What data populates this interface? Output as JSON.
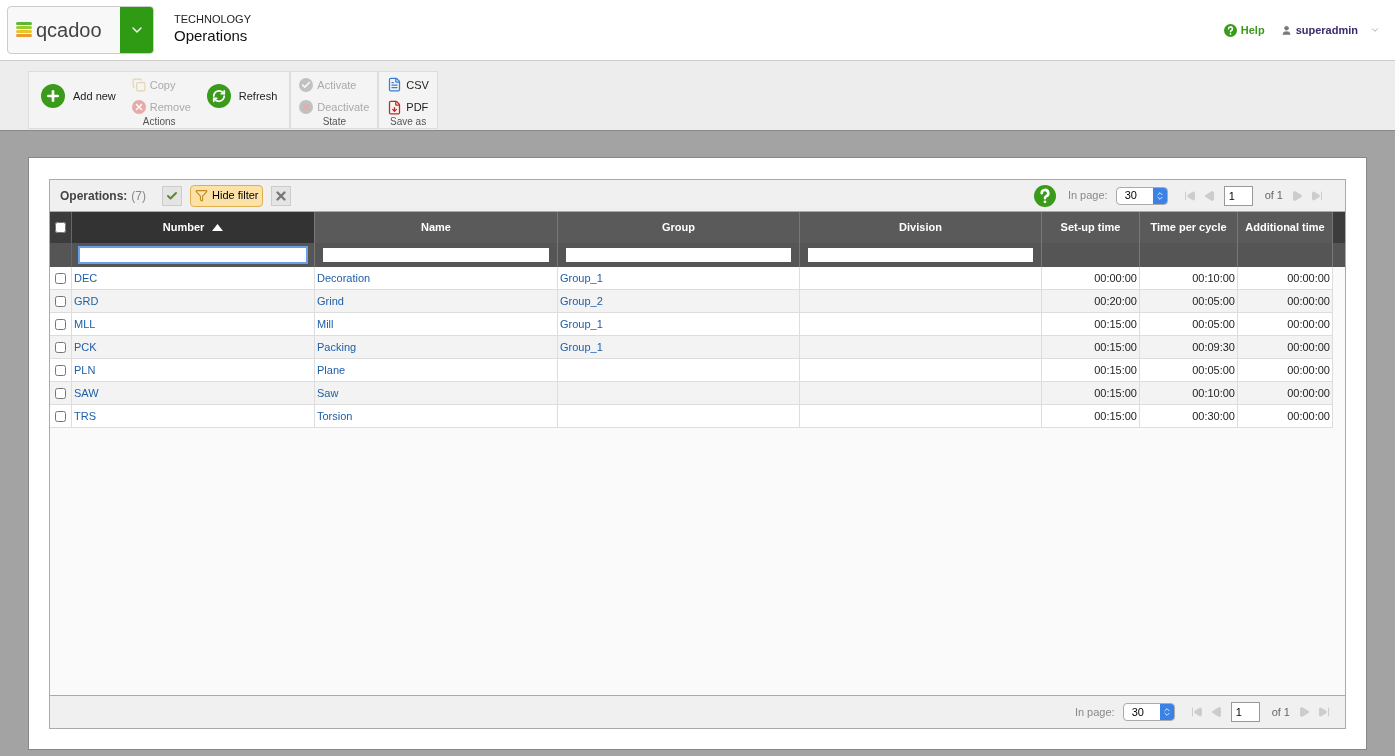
{
  "header": {
    "logo": "qcadoo",
    "section": "TECHNOLOGY",
    "title": "Operations",
    "help": "Help",
    "user": "superadmin"
  },
  "toolbar": [
    {
      "label": "Actions",
      "buttons": [
        {
          "label": "Add new",
          "kind": "add",
          "disabled": false
        },
        {
          "label": "Copy",
          "kind": "copy",
          "disabled": true
        },
        {
          "label": "Remove",
          "kind": "remove",
          "disabled": true
        },
        {
          "label": "Refresh",
          "kind": "refresh",
          "disabled": false
        }
      ]
    },
    {
      "label": "State",
      "buttons": [
        {
          "label": "Activate",
          "kind": "activate",
          "disabled": true
        },
        {
          "label": "Deactivate",
          "kind": "deactivate",
          "disabled": true
        }
      ]
    },
    {
      "label": "Save as",
      "buttons": [
        {
          "label": "CSV",
          "kind": "csv",
          "disabled": false
        },
        {
          "label": "PDF",
          "kind": "pdf",
          "disabled": false
        }
      ]
    }
  ],
  "grid": {
    "title": "Operations:",
    "count": "(7)",
    "filter_button": "Hide filter",
    "filter_on": true,
    "all_checked": false,
    "columns": [
      {
        "label": "Number",
        "sorted": true,
        "kind": "link"
      },
      {
        "label": "Name",
        "sorted": false,
        "kind": "link"
      },
      {
        "label": "Group",
        "sorted": false,
        "kind": "link"
      },
      {
        "label": "Division",
        "sorted": false,
        "kind": "link"
      },
      {
        "label": "Set-up time",
        "sorted": false,
        "kind": "time"
      },
      {
        "label": "Time per cycle",
        "sorted": false,
        "kind": "time"
      },
      {
        "label": "Additional time",
        "sorted": false,
        "kind": "time"
      }
    ],
    "rows": [
      {
        "checked": false,
        "cells": [
          "DEC",
          "Decoration",
          "Group_1",
          "",
          "00:00:00",
          "00:10:00",
          "00:00:00"
        ]
      },
      {
        "checked": false,
        "cells": [
          "GRD",
          "Grind",
          "Group_2",
          "",
          "00:20:00",
          "00:05:00",
          "00:00:00"
        ]
      },
      {
        "checked": false,
        "cells": [
          "MLL",
          "Mill",
          "Group_1",
          "",
          "00:15:00",
          "00:05:00",
          "00:00:00"
        ]
      },
      {
        "checked": false,
        "cells": [
          "PCK",
          "Packing",
          "Group_1",
          "",
          "00:15:00",
          "00:09:30",
          "00:00:00"
        ]
      },
      {
        "checked": false,
        "cells": [
          "PLN",
          "Plane",
          "",
          "",
          "00:15:00",
          "00:05:00",
          "00:00:00"
        ]
      },
      {
        "checked": false,
        "cells": [
          "SAW",
          "Saw",
          "",
          "",
          "00:15:00",
          "00:10:00",
          "00:00:00"
        ]
      },
      {
        "checked": false,
        "cells": [
          "TRS",
          "Torsion",
          "",
          "",
          "00:15:00",
          "00:30:00",
          "00:00:00"
        ]
      }
    ],
    "pagers": [
      {
        "in_page_label": "In page:",
        "per_page": "30",
        "page": "1",
        "of": "of 1"
      },
      {
        "in_page_label": "In page:",
        "per_page": "30",
        "page": "1",
        "of": "of 1"
      }
    ]
  }
}
